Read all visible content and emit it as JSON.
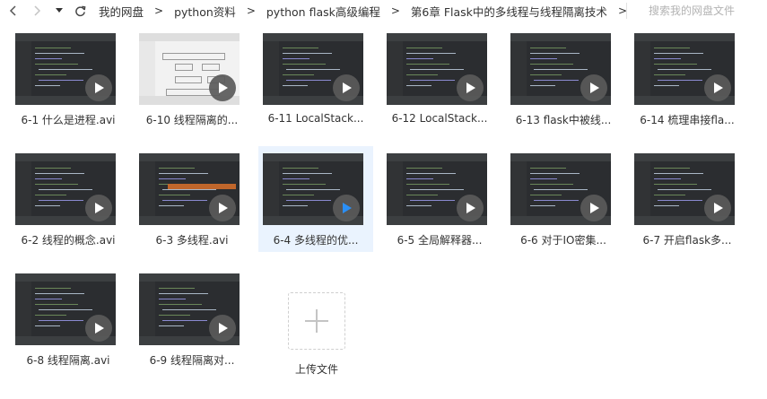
{
  "nav": {
    "back_icon": "chevron-left-icon",
    "forward_icon": "chevron-right-icon",
    "history_icon": "caret-down-icon",
    "refresh_icon": "refresh-icon",
    "breadcrumbs": [
      "我的网盘",
      "python资料",
      "python flask高级编程",
      "第6章 Flask中的多线程与线程隔离技术"
    ],
    "separator": ">"
  },
  "search": {
    "placeholder": "搜索我的网盘文件"
  },
  "files": [
    {
      "name": "6-1 什么是进程.avi",
      "thumb": "dark"
    },
    {
      "name": "6-10 线程隔离的...",
      "thumb": "light"
    },
    {
      "name": "6-11 LocalStack...",
      "thumb": "dark"
    },
    {
      "name": "6-12 LocalStack...",
      "thumb": "dark"
    },
    {
      "name": "6-13 flask中被线...",
      "thumb": "dark"
    },
    {
      "name": "6-14 梳理串接fla...",
      "thumb": "dark"
    },
    {
      "name": "6-2 线程的概念.avi",
      "thumb": "dark"
    },
    {
      "name": "6-3 多线程.avi",
      "thumb": "dark-highlight"
    },
    {
      "name": "6-4 多线程的优...",
      "thumb": "dark",
      "selected": true
    },
    {
      "name": "6-5 全局解释器...",
      "thumb": "dark"
    },
    {
      "name": "6-6 对于IO密集...",
      "thumb": "dark"
    },
    {
      "name": "6-7 开启flask多...",
      "thumb": "dark"
    },
    {
      "name": "6-8 线程隔离.avi",
      "thumb": "dark"
    },
    {
      "name": "6-9 线程隔离对...",
      "thumb": "dark"
    }
  ],
  "upload": {
    "label": "上传文件",
    "icon": "plus-icon"
  },
  "colors": {
    "selected_bg": "#eaf3fe",
    "play_active": "#2b8ff5",
    "play_idle": "#ffffff"
  }
}
